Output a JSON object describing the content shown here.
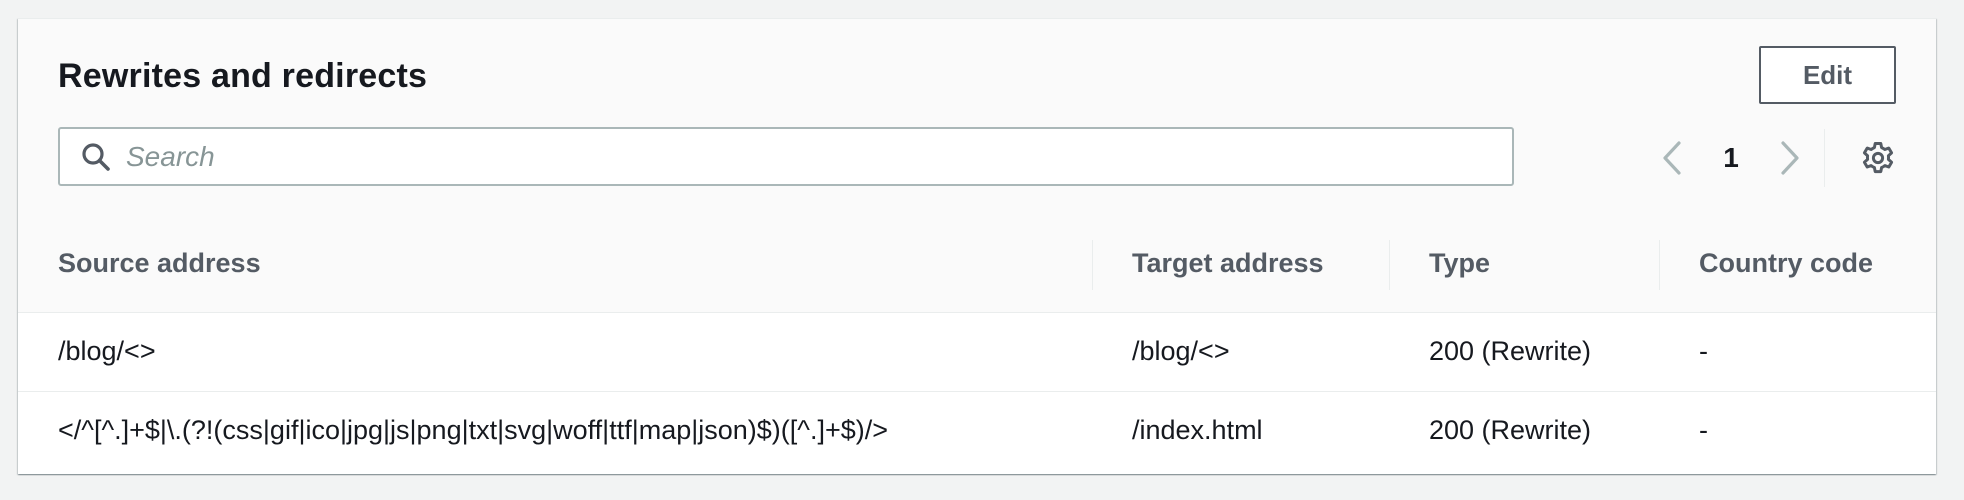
{
  "panel": {
    "title": "Rewrites and redirects",
    "edit_label": "Edit"
  },
  "search": {
    "placeholder": "Search",
    "value": ""
  },
  "pagination": {
    "current_page": "1",
    "prev_icon": "chevron-left-icon",
    "next_icon": "chevron-right-icon"
  },
  "settings": {
    "icon": "gear-icon"
  },
  "table": {
    "columns": [
      {
        "label": "Source address"
      },
      {
        "label": "Target address"
      },
      {
        "label": "Type"
      },
      {
        "label": "Country code"
      }
    ],
    "rows": [
      {
        "source": "/blog/<>",
        "target": "/blog/<>",
        "type": "200 (Rewrite)",
        "country": "-"
      },
      {
        "source": "</^[^.]+$|\\.(?!(css|gif|ico|jpg|js|png|txt|svg|woff|ttf|map|json)$)([^.]+$)/>",
        "target": "/index.html",
        "type": "200 (Rewrite)",
        "country": "-"
      }
    ]
  },
  "colors": {
    "text": "#16191f",
    "secondary_text": "#545b64",
    "border": "#eaeded",
    "header_bg": "#fafafa",
    "disabled_icon": "#aab7b8"
  }
}
